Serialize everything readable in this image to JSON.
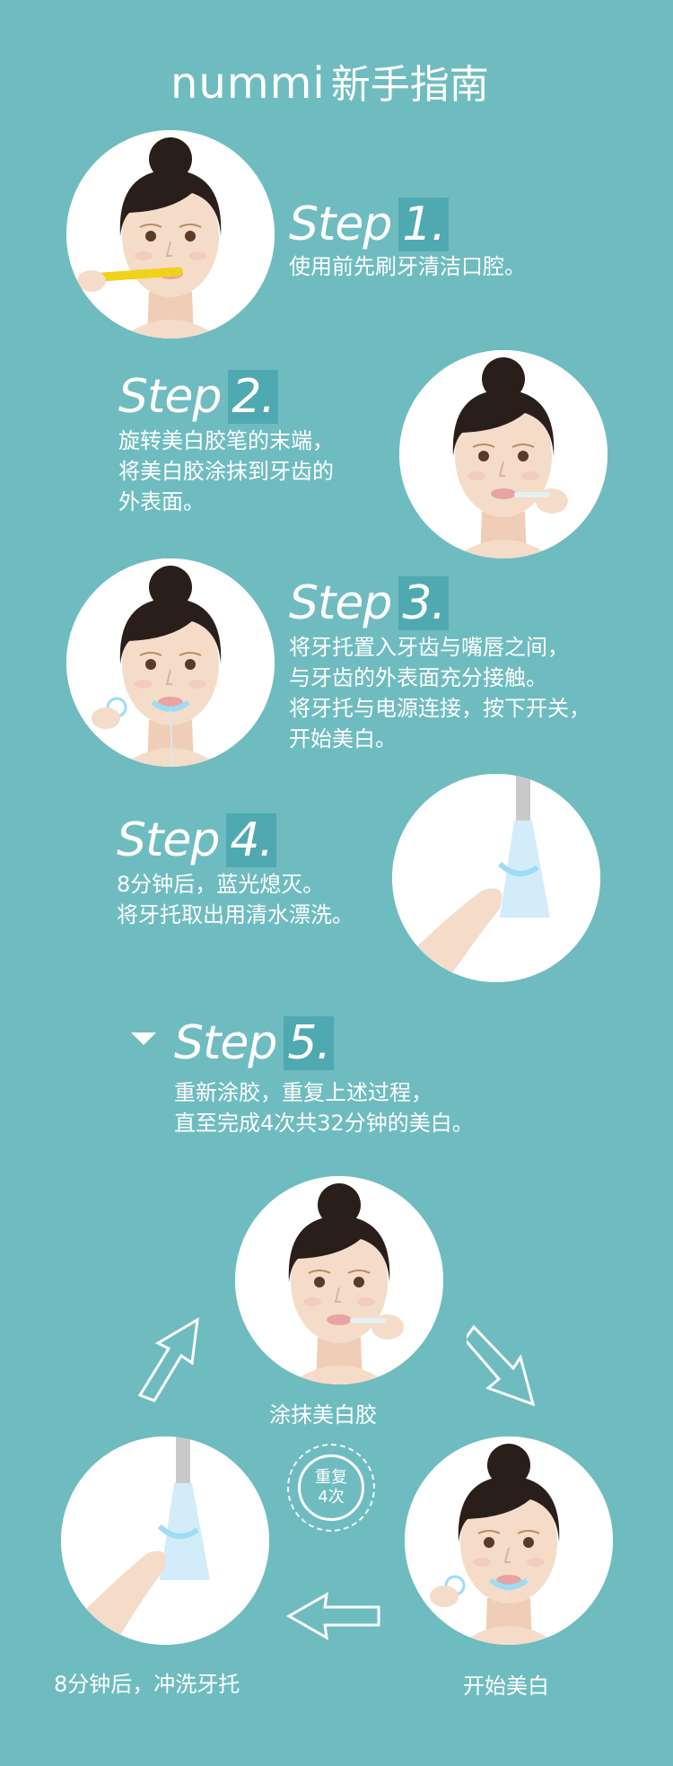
{
  "header": {
    "logo": "nummi",
    "title": "新手指南"
  },
  "steps": [
    {
      "label": "Step",
      "num": "1.",
      "lines": [
        "使用前先刷牙清洁口腔。"
      ]
    },
    {
      "label": "Step",
      "num": "2.",
      "lines": [
        "旋转美白胶笔的末端，",
        "将美白胶涂抹到牙齿的",
        "外表面。"
      ]
    },
    {
      "label": "Step",
      "num": "3.",
      "lines": [
        "将牙托置入牙齿与嘴唇之间，",
        "与牙齿的外表面充分接触。",
        "将牙托与电源连接，按下开关，",
        "开始美白。"
      ]
    },
    {
      "label": "Step",
      "num": "4.",
      "lines": [
        "8分钟后，蓝光熄灭。",
        "将牙托取出用清水漂洗。"
      ]
    },
    {
      "label": "Step",
      "num": "5.",
      "lines": [
        "重新涂胶，重复上述过程，",
        "直至完成4次共32分钟的美白。"
      ]
    }
  ],
  "cycle": {
    "top_label": "涂抹美白胶",
    "right_label": "开始美白",
    "left_label": "8分钟后，冲洗牙托",
    "badge_line1": "重复",
    "badge_line2": "4次"
  },
  "colors": {
    "background": "#6fbcc0",
    "accent": "#4fa9b0",
    "hair": "#2a1e1b",
    "skin": "#f5dcc8",
    "brush": "#f1d21a",
    "light": "#4aa6e6"
  }
}
